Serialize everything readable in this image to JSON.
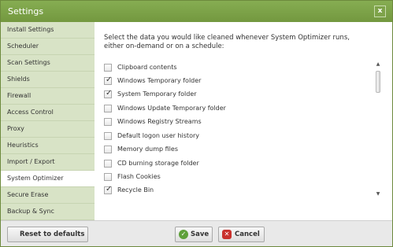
{
  "window": {
    "title": "Settings",
    "close_glyph": "x"
  },
  "sidebar": {
    "items": [
      {
        "label": "Install Settings",
        "active": false
      },
      {
        "label": "Scheduler",
        "active": false
      },
      {
        "label": "Scan Settings",
        "active": false
      },
      {
        "label": "Shields",
        "active": false
      },
      {
        "label": "Firewall",
        "active": false
      },
      {
        "label": "Access Control",
        "active": false
      },
      {
        "label": "Proxy",
        "active": false
      },
      {
        "label": "Heuristics",
        "active": false
      },
      {
        "label": "Import / Export",
        "active": false
      },
      {
        "label": "System Optimizer",
        "active": true
      },
      {
        "label": "Secure Erase",
        "active": false
      },
      {
        "label": "Backup & Sync",
        "active": false
      }
    ]
  },
  "content": {
    "intro": "Select the data you would like cleaned whenever System Optimizer runs, either on-demand or on a schedule:",
    "options": [
      {
        "label": "Clipboard contents",
        "checked": false
      },
      {
        "label": "Windows Temporary folder",
        "checked": true
      },
      {
        "label": "System Temporary folder",
        "checked": true
      },
      {
        "label": "Windows Update Temporary folder",
        "checked": false
      },
      {
        "label": "Windows Registry Streams",
        "checked": false
      },
      {
        "label": "Default logon user history",
        "checked": false
      },
      {
        "label": "Memory dump files",
        "checked": false
      },
      {
        "label": "CD burning storage folder",
        "checked": false
      },
      {
        "label": "Flash Cookies",
        "checked": false
      },
      {
        "label": "Recycle Bin",
        "checked": true
      }
    ]
  },
  "footer": {
    "reset_label": "Reset to defaults",
    "save_label": "Save",
    "cancel_label": "Cancel"
  },
  "colors": {
    "titlebar": "#7ea34a",
    "sidebar_bg": "#d8e3c6",
    "save_icon": "#5ea03a",
    "cancel_icon": "#c9302c"
  },
  "icons": {
    "checkmark": "check-icon",
    "save": "ok-icon",
    "cancel": "cancel-icon",
    "scroll_up": "chevron-up-icon",
    "scroll_down": "chevron-down-icon"
  }
}
